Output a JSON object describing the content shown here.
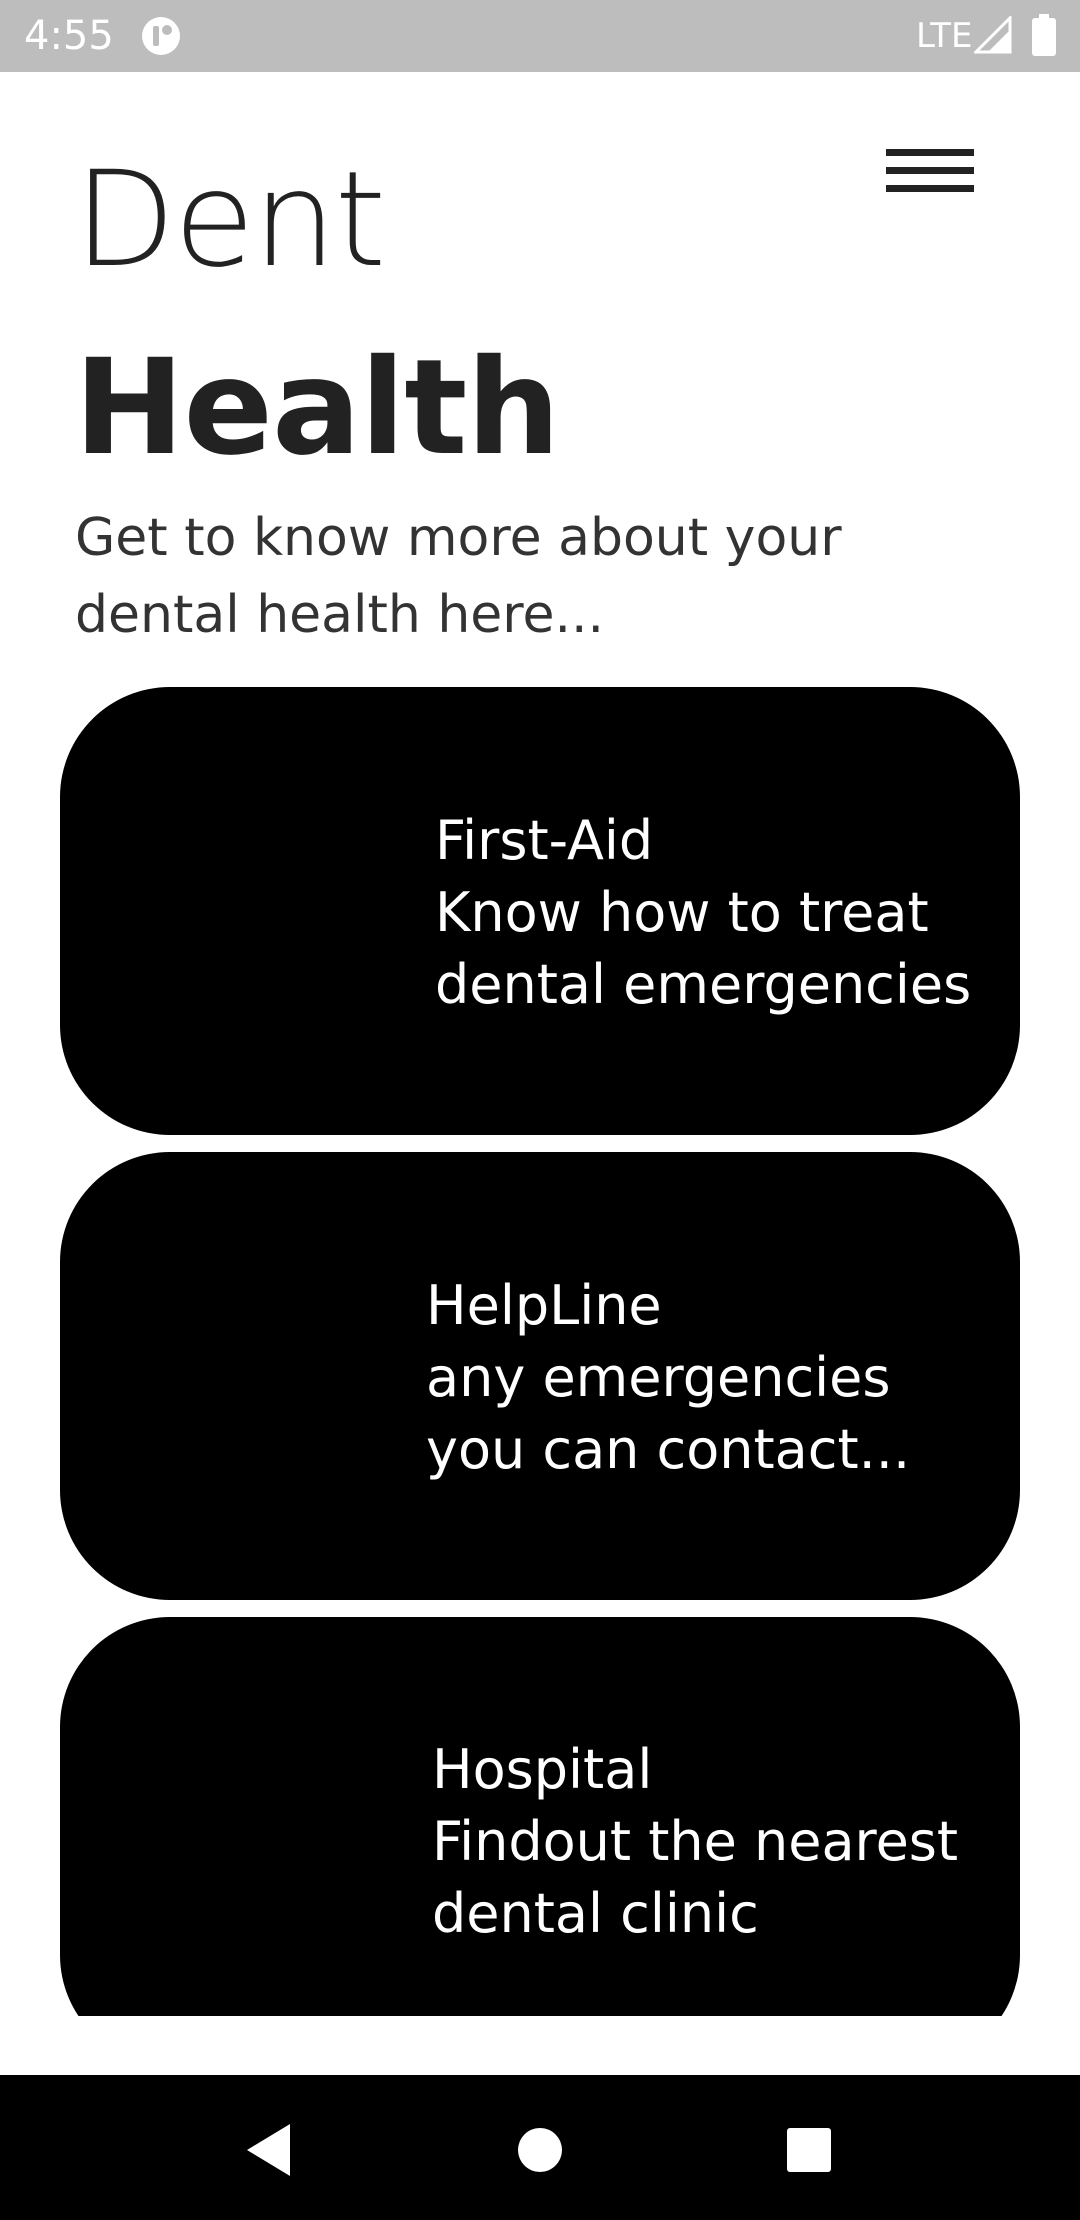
{
  "status_bar": {
    "time": "4:55",
    "network": "LTE"
  },
  "header": {
    "title_light": "Dent",
    "title_bold": "Health",
    "subtitle_line1": "Get to know more about your",
    "subtitle_line2": "dental health here..."
  },
  "cards": [
    {
      "title": "First-Aid",
      "line1": "Know how to treat",
      "line2": "dental emergencies"
    },
    {
      "title": "HelpLine",
      "line1": "any emergencies",
      "line2": "you can contact..."
    },
    {
      "title": "Hospital",
      "line1": "Findout the nearest",
      "line2": "dental clinic"
    }
  ],
  "icons": {
    "menu": "hamburger-menu-icon",
    "back": "back-triangle-icon",
    "home": "home-circle-icon",
    "recents": "recents-square-icon"
  },
  "colors": {
    "status_bar": "#bdbdbd",
    "card_background": "#000000",
    "text": "#222222",
    "nav_bar": "#000000"
  }
}
